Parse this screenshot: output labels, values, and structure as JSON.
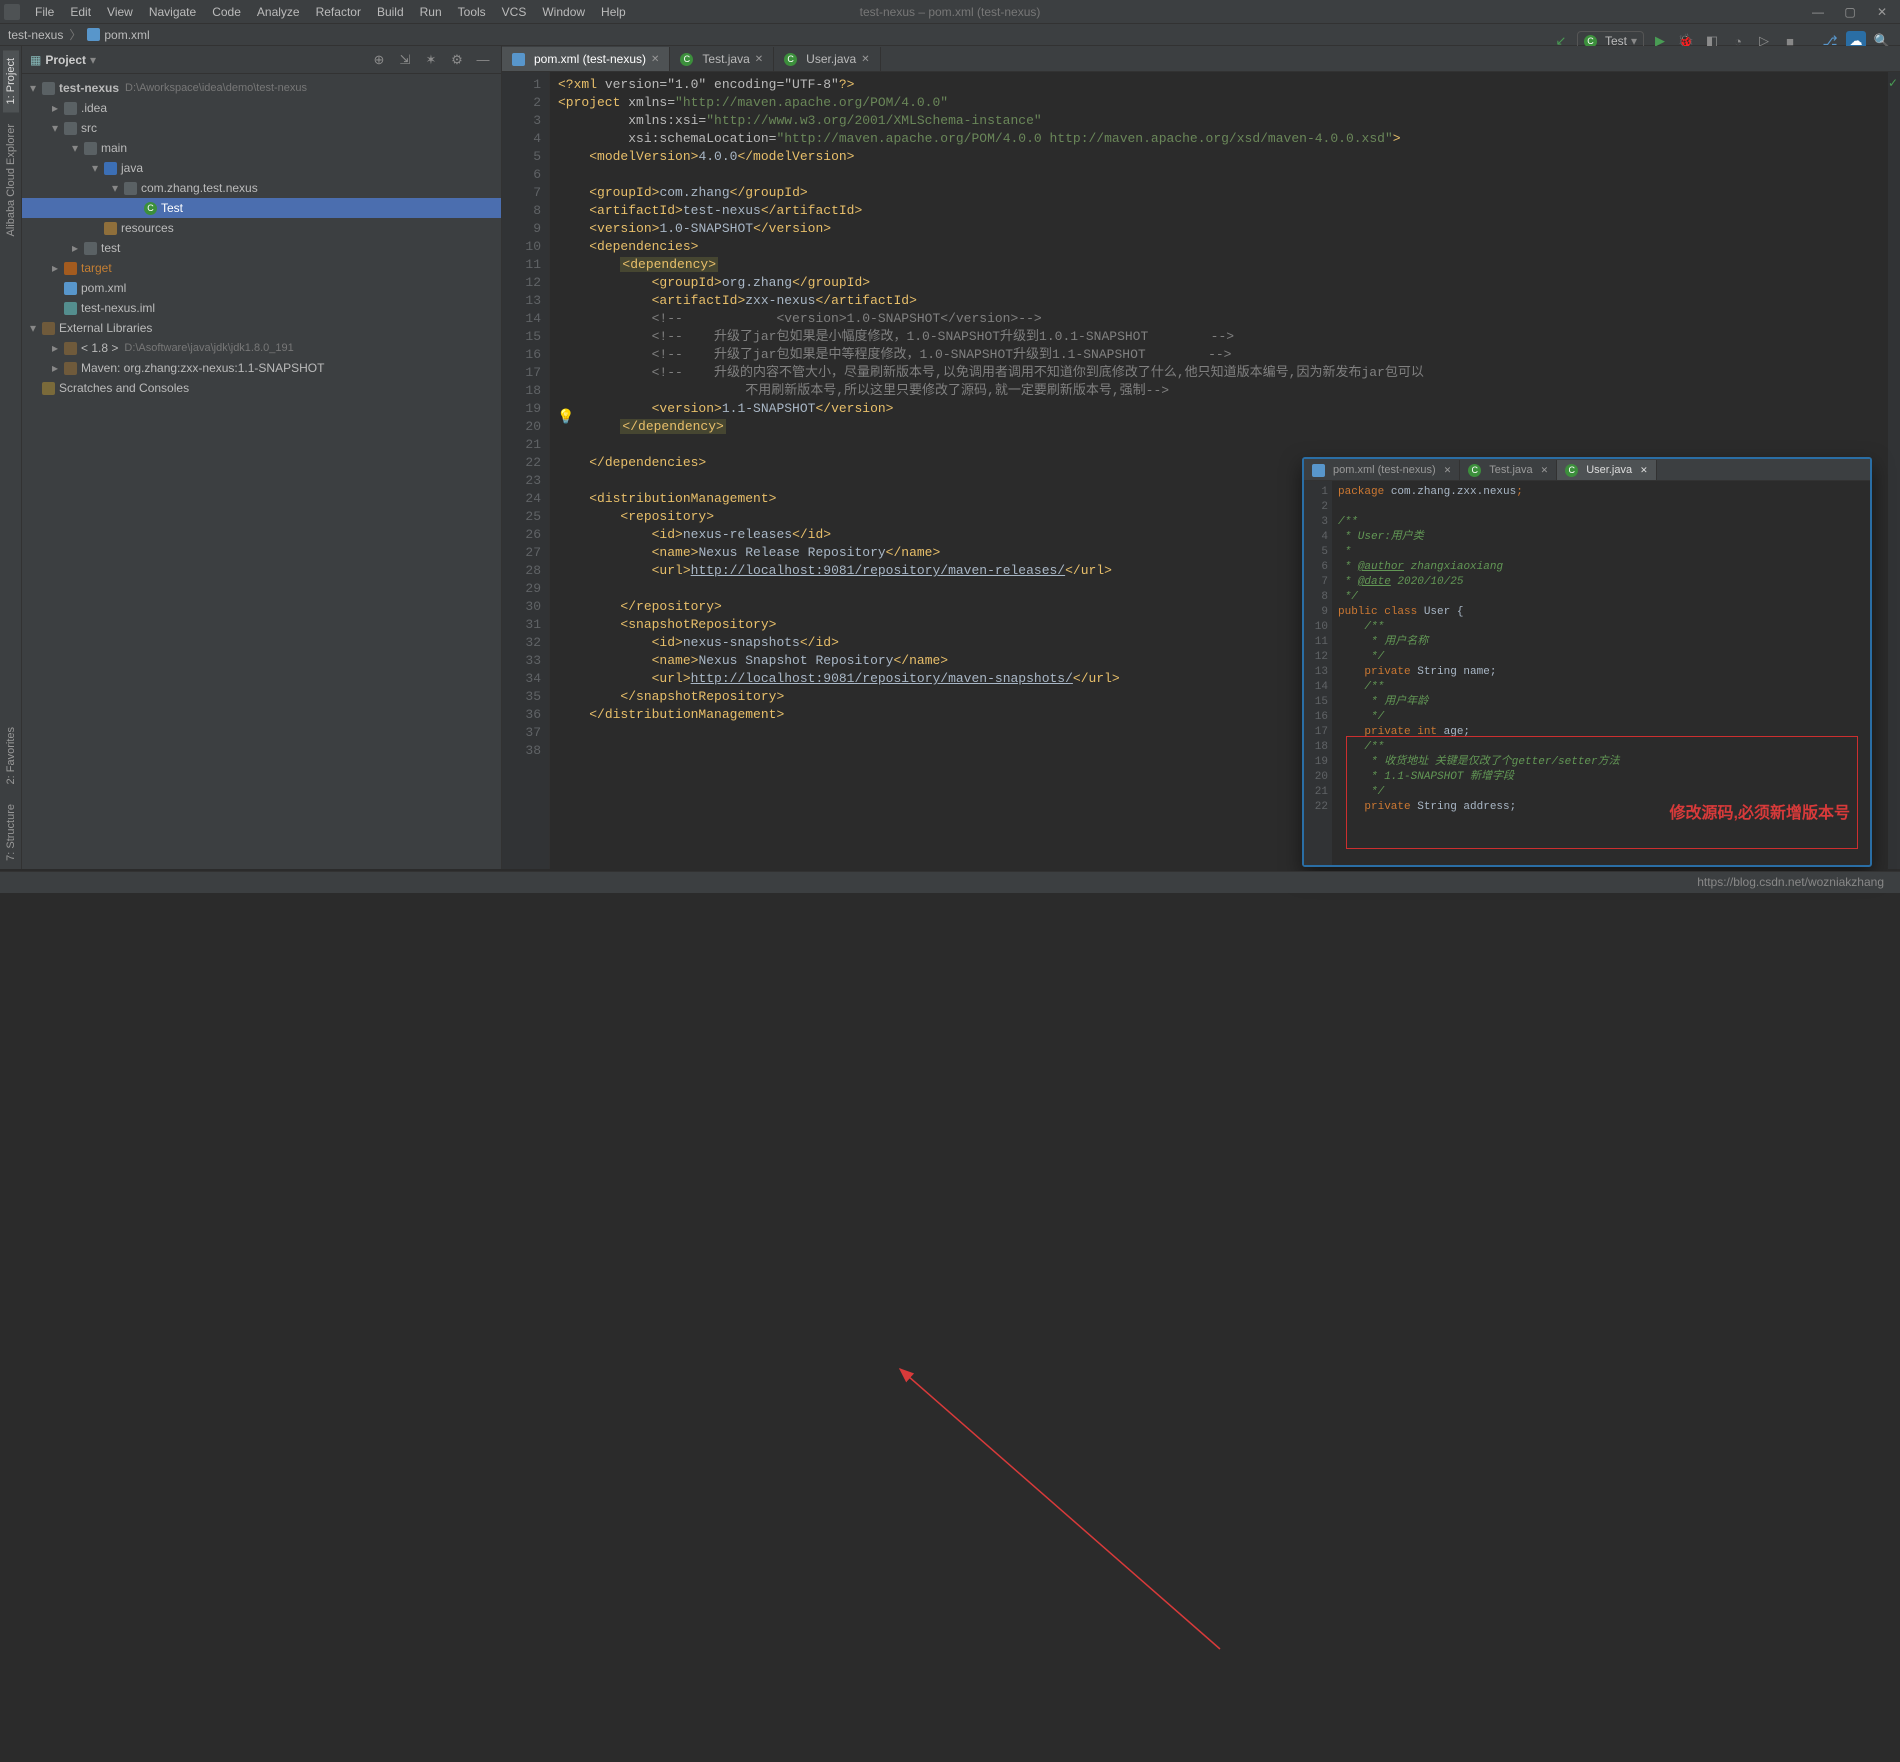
{
  "title": "test-nexus – pom.xml (test-nexus)",
  "menu": [
    "File",
    "Edit",
    "View",
    "Navigate",
    "Code",
    "Analyze",
    "Refactor",
    "Build",
    "Run",
    "Tools",
    "VCS",
    "Window",
    "Help"
  ],
  "breadcrumb": {
    "root": "test-nexus",
    "file": "pom.xml"
  },
  "run_config": "Test",
  "vtabs_left": [
    "1: Project",
    "Alibaba Cloud Explorer"
  ],
  "vtabs_bottom_left": [
    "2: Favorites",
    "7: Structure"
  ],
  "project_panel": {
    "title": "Project",
    "tree": {
      "root": {
        "name": "test-nexus",
        "path": "D:\\Aworkspace\\idea\\demo\\test-nexus"
      },
      "idea": ".idea",
      "src": "src",
      "main": "main",
      "java": "java",
      "pkg": "com.zhang.test.nexus",
      "cls": "Test",
      "resources": "resources",
      "test": "test",
      "target": "target",
      "pom": "pom.xml",
      "iml": "test-nexus.iml",
      "ext": "External Libraries",
      "jdk": "< 1.8 >",
      "jdk_path": "D:\\Asoftware\\java\\jdk\\jdk1.8.0_191",
      "maven_lib": "Maven: org.zhang:zxx-nexus:1.1-SNAPSHOT",
      "scratches": "Scratches and Consoles"
    }
  },
  "editor_tabs": [
    {
      "label": "pom.xml (test-nexus)",
      "icon": "m",
      "active": true
    },
    {
      "label": "Test.java",
      "icon": "c",
      "active": false
    },
    {
      "label": "User.java",
      "icon": "c",
      "active": false
    }
  ],
  "code_xml": {
    "lines": [
      1,
      2,
      3,
      4,
      5,
      6,
      7,
      8,
      9,
      10,
      11,
      12,
      13,
      14,
      15,
      16,
      17,
      18,
      19,
      20,
      21,
      22,
      23,
      24,
      25,
      26,
      27,
      28,
      29,
      30,
      31,
      32,
      33,
      34,
      35,
      36,
      37,
      38
    ],
    "l1": {
      "decl": "<?xml ",
      "attrs": "version=\"1.0\" encoding=\"UTF-8\"",
      "end": "?>"
    },
    "l2": {
      "open": "<project ",
      "a": "xmlns=",
      "v": "\"http://maven.apache.org/POM/4.0.0\""
    },
    "l3": {
      "a": "xmlns:xsi=",
      "v": "\"http://www.w3.org/2001/XMLSchema-instance\""
    },
    "l4": {
      "a": "xsi:schemaLocation=",
      "v": "\"http://maven.apache.org/POM/4.0.0 http://maven.apache.org/xsd/maven-4.0.0.xsd\"",
      "end": ">"
    },
    "l5": {
      "o": "<modelVersion>",
      "t": "4.0.0",
      "c": "</modelVersion>"
    },
    "l7": {
      "o": "<groupId>",
      "t": "com.zhang",
      "c": "</groupId>"
    },
    "l8": {
      "o": "<artifactId>",
      "t": "test-nexus",
      "c": "</artifactId>"
    },
    "l9": {
      "o": "<version>",
      "t": "1.0-SNAPSHOT",
      "c": "</version>"
    },
    "l10": {
      "o": "<dependencies>"
    },
    "l11": {
      "o": "<dependency>"
    },
    "l12": {
      "o": "<groupId>",
      "t": "org.zhang",
      "c": "</groupId>"
    },
    "l13": {
      "o": "<artifactId>",
      "t": "zxx-nexus",
      "c": "</artifactId>"
    },
    "l14": "<!--            <version>1.0-SNAPSHOT</version>-->",
    "l15": "<!--    升级了jar包如果是小幅度修改，1.0-SNAPSHOT升级到1.0.1-SNAPSHOT        -->",
    "l16": "<!--    升级了jar包如果是中等程度修改，1.0-SNAPSHOT升级到1.1-SNAPSHOT        -->",
    "l17": "<!--    升级的内容不管大小，尽量刷新版本号,以免调用者调用不知道你到底修改了什么,他只知道版本编号,因为新发布jar包可以",
    "l18": "            不用刷新版本号,所以这里只要修改了源码,就一定要刷新版本号,强制-->",
    "l19": {
      "o": "<version>",
      "t": "1.1-SNAPSHOT",
      "c": "</version>"
    },
    "l20": {
      "c": "</dependency>"
    },
    "l22": {
      "c": "</dependencies>"
    },
    "l24": {
      "o": "<distributionManagement>"
    },
    "l25": {
      "o": "<repository>"
    },
    "l26": {
      "o": "<id>",
      "t": "nexus-releases",
      "c": "</id>"
    },
    "l27": {
      "o": "<name>",
      "t": "Nexus Release Repository",
      "c": "</name>"
    },
    "l28": {
      "o": "<url>",
      "t": "http://localhost:9081/repository/maven-releases/",
      "c": "</url>"
    },
    "l30": {
      "c": "</repository>"
    },
    "l31": {
      "o": "<snapshotRepository>"
    },
    "l32": {
      "o": "<id>",
      "t": "nexus-snapshots",
      "c": "</id>"
    },
    "l33": {
      "o": "<name>",
      "t": "Nexus Snapshot Repository",
      "c": "</name>"
    },
    "l34": {
      "o": "<url>",
      "t": "http://localhost:9081/repository/maven-snapshots/",
      "c": "</url>"
    },
    "l35": {
      "c": "</snapshotRepository>"
    },
    "l36": {
      "c": "</distributionManagement>"
    }
  },
  "preview": {
    "tabs": [
      {
        "label": "pom.xml (test-nexus)",
        "icon": "m",
        "active": false
      },
      {
        "label": "Test.java",
        "icon": "c",
        "active": false
      },
      {
        "label": "User.java",
        "icon": "c",
        "active": true
      }
    ],
    "lines": [
      1,
      2,
      3,
      4,
      5,
      6,
      7,
      8,
      9,
      10,
      11,
      12,
      13,
      14,
      15,
      16,
      17,
      18,
      19,
      20,
      21,
      22
    ],
    "pkg": "package com.zhang.zxx.nexus;",
    "doc1": "/**",
    "doc2": " * User:用户类",
    "doc3": " *",
    "doc4a": " * ",
    "doc4b": "@author",
    "doc4c": " zhangxiaoxiang",
    "doc5a": " * ",
    "doc5b": "@date",
    "doc5c": " 2020/10/25",
    "doc6": " */",
    "cls_a": "public ",
    "cls_b": "class ",
    "cls_c": "User ",
    "cls_d": "{",
    "d10": "    /**",
    "d11": "     * 用户名称",
    "d12": "     */",
    "p13a": "    private ",
    "p13b": "String name;",
    "d14": "    /**",
    "d15": "     * 用户年龄",
    "d16": "     */",
    "p17a": "    private ",
    "p17b": "int ",
    "p17c": "age;",
    "d18": "    /**",
    "d19": "     * 收货地址 关键是仅改了个getter/setter方法",
    "d20": "     * 1.1-SNAPSHOT 新增字段",
    "d21": "     */",
    "p22a": "    private ",
    "p22b": "String address;"
  },
  "annotation": "修改源码,必须新增版本号",
  "watermark": "https://blog.csdn.net/wozniakzhang"
}
